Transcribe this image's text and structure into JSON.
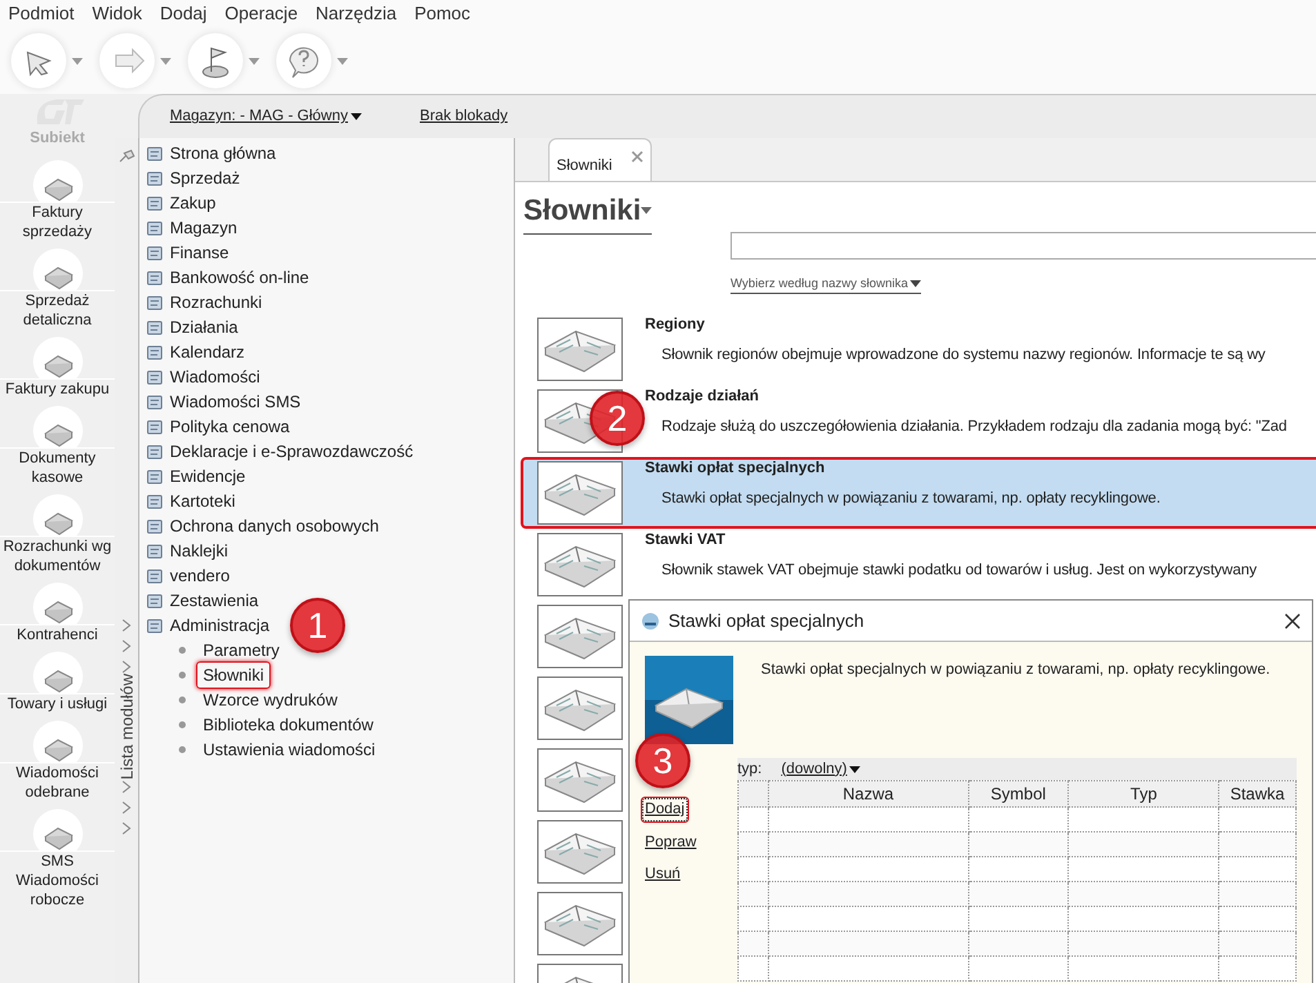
{
  "menu": [
    "Podmiot",
    "Widok",
    "Dodaj",
    "Operacje",
    "Narzędzia",
    "Pomoc"
  ],
  "toolbar": [
    {
      "kind": "arrow_left"
    },
    {
      "kind": "arrow_right"
    },
    {
      "kind": "flag"
    },
    {
      "kind": "help"
    }
  ],
  "app_logo": {
    "text": "Subiekt"
  },
  "sidebar": [
    {
      "label": "Faktury sprzedaży"
    },
    {
      "label": "Sprzedaż detaliczna"
    },
    {
      "label": "Faktury zakupu"
    },
    {
      "label": "Dokumenty kasowe"
    },
    {
      "label": "Rozrachunki wg dokumentów"
    },
    {
      "label": "Kontrahenci"
    },
    {
      "label": "Towary i usługi"
    },
    {
      "label": "Wiadomości odebrane"
    },
    {
      "label": "SMS Wiadomości robocze"
    }
  ],
  "warehouse": {
    "label": "Magazyn: - MAG - Główny"
  },
  "lock_status": "Brak blokady",
  "module_panel": {
    "title": "Lista modułów",
    "modules": [
      {
        "label": "Strona główna"
      },
      {
        "label": "Sprzedaż"
      },
      {
        "label": "Zakup"
      },
      {
        "label": "Magazyn"
      },
      {
        "label": "Finanse"
      },
      {
        "label": "Bankowość on-line"
      },
      {
        "label": "Rozrachunki"
      },
      {
        "label": "Działania"
      },
      {
        "label": "Kalendarz"
      },
      {
        "label": "Wiadomości"
      },
      {
        "label": "Wiadomości SMS"
      },
      {
        "label": "Polityka cenowa"
      },
      {
        "label": "Deklaracje i e-Sprawozdawczość"
      },
      {
        "label": "Ewidencje"
      },
      {
        "label": "Kartoteki"
      },
      {
        "label": "Ochrona danych osobowych"
      },
      {
        "label": "Naklejki"
      },
      {
        "label": "vendero"
      },
      {
        "label": "Zestawienia"
      },
      {
        "label": "Administracja",
        "children": [
          {
            "label": "Parametry",
            "highlighted": false
          },
          {
            "label": "Słowniki",
            "highlighted": true
          },
          {
            "label": "Wzorce wydruków",
            "highlighted": false
          },
          {
            "label": "Biblioteka dokumentów",
            "highlighted": false
          },
          {
            "label": "Ustawienia wiadomości",
            "highlighted": false
          }
        ]
      }
    ]
  },
  "tabs": [
    {
      "label": "Słowniki",
      "selected": true
    }
  ],
  "page_title": "Słowniki",
  "filter_link": "Wybierz według nazwy słownika",
  "dictionaries": [
    {
      "kind": "entry",
      "title": "Regiony",
      "description": "Słownik regionów obejmuje wprowadzone do systemu nazwy regionów. Informacje te są wy",
      "selected": false,
      "highlighted": false
    },
    {
      "kind": "entry",
      "title": "Rodzaje działań",
      "description": "Rodzaje służą do uszczegółowienia działania. Przykładem rodzaju dla zadania mogą być: \"Zad",
      "selected": false,
      "highlighted": false
    },
    {
      "kind": "entry",
      "title": "Stawki opłat specjalnych",
      "description": "Stawki opłat specjalnych w powiązaniu z towarami, np. opłaty recyklingowe.",
      "selected": true,
      "highlighted": true
    },
    {
      "kind": "entry",
      "title": "Stawki VAT",
      "description": "Słownik stawek VAT obejmuje stawki podatku od towarów i usług. Jest on wykorzystywany",
      "selected": false,
      "highlighted": false
    },
    {
      "kind": "covered",
      "selected": false,
      "highlighted": false
    },
    {
      "kind": "covered",
      "selected": false,
      "highlighted": false
    },
    {
      "kind": "covered",
      "selected": false,
      "highlighted": false
    },
    {
      "kind": "covered",
      "selected": false,
      "highlighted": false
    },
    {
      "kind": "covered",
      "selected": false,
      "highlighted": false
    },
    {
      "kind": "covered",
      "selected": false,
      "highlighted": false
    }
  ],
  "dialog": {
    "title": "Stawki opłat specjalnych",
    "description": "Stawki opłat specjalnych w powiązaniu z towarami, np. opłaty recyklingowe.",
    "actions": [
      {
        "label": "Dodaj",
        "highlighted": true
      },
      {
        "label": "Popraw",
        "highlighted": false
      },
      {
        "label": "Usuń",
        "highlighted": false
      }
    ],
    "filter": {
      "label": "typ:",
      "value": "(dowolny)"
    },
    "table": {
      "columns": [
        "Nazwa",
        "Symbol",
        "Typ",
        "Stawka"
      ]
    }
  },
  "annotations": [
    {
      "label": "1"
    },
    {
      "label": "2"
    },
    {
      "label": "3"
    }
  ]
}
